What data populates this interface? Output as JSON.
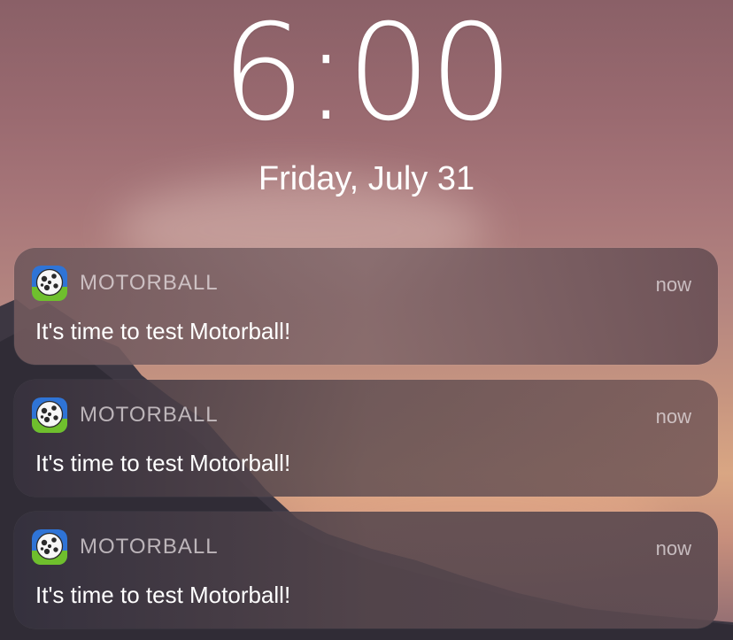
{
  "lock_screen": {
    "time": "6:00",
    "date": "Friday, July 31"
  },
  "notifications": [
    {
      "app_name": "MOTORBALL",
      "app_icon": "motorball-app-icon",
      "timestamp": "now",
      "message": "It's time to test Motorball!"
    },
    {
      "app_name": "MOTORBALL",
      "app_icon": "motorball-app-icon",
      "timestamp": "now",
      "message": "It's time to test Motorball!"
    },
    {
      "app_name": "MOTORBALL",
      "app_icon": "motorball-app-icon",
      "timestamp": "now",
      "message": "It's time to test Motorball!"
    }
  ],
  "colors": {
    "text_primary": "#ffffff",
    "text_secondary": "#b8adb2",
    "icon_sky": "#2f74d6",
    "icon_grass": "#6fbf2d"
  }
}
